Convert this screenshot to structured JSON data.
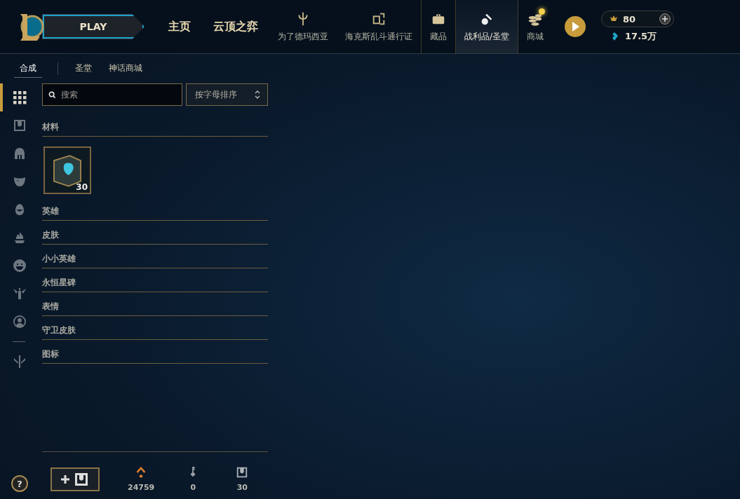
{
  "header": {
    "play_button": "PLAY",
    "text_tabs": [
      {
        "label": "主页",
        "selected": false
      },
      {
        "label": "云顶之弈",
        "selected": false
      }
    ],
    "icon_tabs": [
      {
        "kind": "trident",
        "label": "为了德玛西亚",
        "selected": false,
        "notification": false
      },
      {
        "kind": "cards",
        "label": "海克斯乱斗通行证",
        "selected": false,
        "notification": false
      },
      {
        "kind": "bag",
        "label": "藏品",
        "selected": false,
        "notification": false
      },
      {
        "kind": "loot",
        "label": "战利品/圣堂",
        "selected": true,
        "notification": false
      },
      {
        "kind": "coins",
        "label": "商城",
        "selected": false,
        "notification": true
      }
    ],
    "riot_points": "80",
    "blue_essence": "17.5万"
  },
  "subtabs": [
    {
      "label": "合成",
      "selected": true
    },
    {
      "label": "圣堂",
      "selected": false
    },
    {
      "label": "神话商城",
      "selected": false
    }
  ],
  "sidebar": [
    [
      {
        "kind": "grid",
        "selected": true
      },
      {
        "kind": "chest",
        "selected": false
      },
      {
        "kind": "helmet",
        "selected": false
      },
      {
        "kind": "mask",
        "selected": false
      },
      {
        "kind": "egg",
        "selected": false
      },
      {
        "kind": "flame",
        "selected": false
      },
      {
        "kind": "smiley",
        "selected": false
      },
      {
        "kind": "totem",
        "selected": false
      },
      {
        "kind": "face",
        "selected": false
      }
    ],
    [
      {
        "kind": "trident",
        "selected": false
      }
    ]
  ],
  "help_button": "?",
  "search": {
    "placeholder": "搜索"
  },
  "sort": {
    "value": "按字母排序"
  },
  "categories": [
    {
      "name": "材料",
      "items": [
        {
          "count": "30"
        }
      ]
    },
    {
      "name": "英雄"
    },
    {
      "name": "皮肤"
    },
    {
      "name": "小小英雄"
    },
    {
      "name": "永恒星碑"
    },
    {
      "name": "表情"
    },
    {
      "name": "守卫皮肤"
    },
    {
      "name": "图标"
    }
  ],
  "footer": {
    "counters": [
      {
        "kind": "orange",
        "value": "24759"
      },
      {
        "kind": "key",
        "value": "0"
      },
      {
        "kind": "chest",
        "value": "30"
      }
    ]
  }
}
